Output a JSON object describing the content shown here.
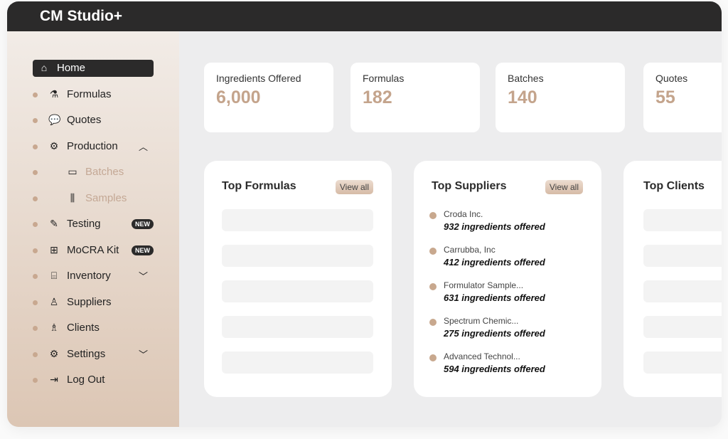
{
  "app": {
    "title": "CM Studio+"
  },
  "sidebar": {
    "items": [
      {
        "label": "Home",
        "icon": "home-icon",
        "glyph": "⌂",
        "active": true
      },
      {
        "label": "Formulas",
        "icon": "flask-icon",
        "glyph": "⚗"
      },
      {
        "label": "Quotes",
        "icon": "chat-icon",
        "glyph": "💬"
      },
      {
        "label": "Production",
        "icon": "gear-icon",
        "glyph": "⚙",
        "chevron": "up"
      },
      {
        "label": "Batches",
        "icon": "box-icon",
        "glyph": "▭",
        "sub": true
      },
      {
        "label": "Samples",
        "icon": "test-tubes-icon",
        "glyph": "⫼",
        "sub": true
      },
      {
        "label": "Testing",
        "icon": "pipette-icon",
        "glyph": "✎",
        "badge": "NEW"
      },
      {
        "label": "MoCRA Kit",
        "icon": "first-aid-kit-icon",
        "glyph": "⊞",
        "badge": "NEW"
      },
      {
        "label": "Inventory",
        "icon": "toolbox-icon",
        "glyph": "⌸",
        "chevron": "down"
      },
      {
        "label": "Suppliers",
        "icon": "worker-icon",
        "glyph": "♙"
      },
      {
        "label": "Clients",
        "icon": "hand-user-icon",
        "glyph": "♗"
      },
      {
        "label": "Settings",
        "icon": "settings-icon",
        "glyph": "⚙",
        "chevron": "down"
      },
      {
        "label": "Log Out",
        "icon": "logout-icon",
        "glyph": "⇥"
      }
    ]
  },
  "stats": [
    {
      "title": "Ingredients Offered",
      "value": "6,000"
    },
    {
      "title": "Formulas",
      "value": "182"
    },
    {
      "title": "Batches",
      "value": "140"
    },
    {
      "title": "Quotes",
      "value": "55"
    }
  ],
  "cards": {
    "formulas": {
      "title": "Top Formulas",
      "view_all": "View all"
    },
    "suppliers": {
      "title": "Top Suppliers",
      "view_all": "View all",
      "items": [
        {
          "name": "Croda Inc.",
          "count": "932 ingredients offered"
        },
        {
          "name": "Carrubba, Inc",
          "count": "412 ingredients offered"
        },
        {
          "name": "Formulator Sample...",
          "count": "631 ingredients offered"
        },
        {
          "name": "Spectrum Chemic...",
          "count": "275 ingredients offered"
        },
        {
          "name": "Advanced Technol...",
          "count": "594 ingredients offered"
        }
      ]
    },
    "clients": {
      "title": "Top Clients"
    }
  },
  "colors": {
    "accent": "#c4a48c",
    "dark": "#2b2a2a"
  }
}
